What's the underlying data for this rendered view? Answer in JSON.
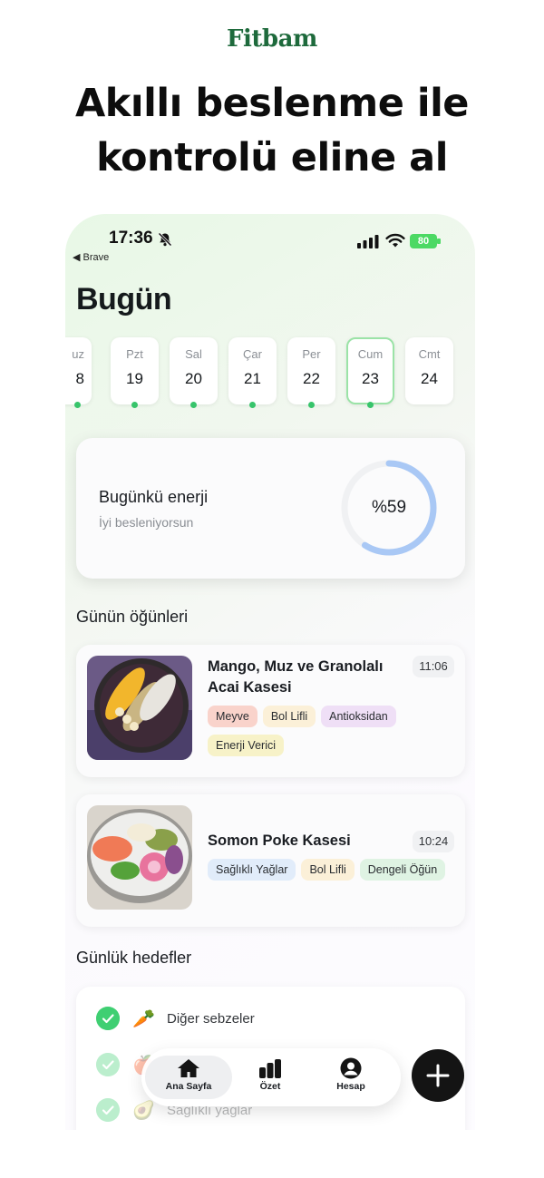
{
  "brand": "Fitbam",
  "headline": [
    "Akıllı beslenme ile",
    "kontrolü eline al"
  ],
  "status_bar": {
    "time": "17:36",
    "back_app": "◀ Brave",
    "battery": "80"
  },
  "page_title": "Bugün",
  "days": [
    {
      "name": "uz",
      "date": "8",
      "dot": true,
      "active": false
    },
    {
      "name": "Pzt",
      "date": "19",
      "dot": true,
      "active": false
    },
    {
      "name": "Sal",
      "date": "20",
      "dot": true,
      "active": false
    },
    {
      "name": "Çar",
      "date": "21",
      "dot": true,
      "active": false
    },
    {
      "name": "Per",
      "date": "22",
      "dot": true,
      "active": false
    },
    {
      "name": "Cum",
      "date": "23",
      "dot": true,
      "active": true
    },
    {
      "name": "Cmt",
      "date": "24",
      "dot": false,
      "active": false
    }
  ],
  "energy": {
    "title": "Bugünkü enerji",
    "subtitle": "İyi besleniyorsun",
    "label": "%59",
    "progress": 0.59,
    "ring_color": "#a9c8f5"
  },
  "meals_section": "Günün öğünleri",
  "meals": [
    {
      "name": "Mango, Muz ve Granolalı Acai Kasesi",
      "time": "11:06",
      "tags": [
        {
          "label": "Meyve",
          "color": "#f9d3cb"
        },
        {
          "label": "Bol Lifli",
          "color": "#fbf0d8"
        },
        {
          "label": "Antioksidan",
          "color": "#efdff6"
        },
        {
          "label": "Enerji Verici",
          "color": "#f7f2c8"
        }
      ]
    },
    {
      "name": "Somon Poke Kasesi",
      "time": "10:24",
      "tags": [
        {
          "label": "Sağlıklı Yağlar",
          "color": "#e1ecfa"
        },
        {
          "label": "Bol Lifli",
          "color": "#fbf0d8"
        },
        {
          "label": "Dengeli Öğün",
          "color": "#dff3e3"
        }
      ]
    }
  ],
  "goals_section": "Günlük hedefler",
  "goals": [
    {
      "icon": "carrot-icon",
      "emoji": "🥕",
      "label": "Diğer sebzeler"
    },
    {
      "icon": "apple-icon",
      "emoji": "🍎",
      "label": ""
    },
    {
      "icon": "avocado-icon",
      "emoji": "🥑",
      "label": "Sağlıklı yağlar"
    }
  ],
  "tabs": [
    {
      "label": "Ana Sayfa",
      "icon": "home-icon",
      "active": true
    },
    {
      "label": "Özet",
      "icon": "bar-chart-icon",
      "active": false
    },
    {
      "label": "Hesap",
      "icon": "user-icon",
      "active": false
    }
  ],
  "colors": {
    "brand": "#1e6a3c",
    "accent_green": "#3fcf72",
    "ring": "#a9c8f5"
  }
}
